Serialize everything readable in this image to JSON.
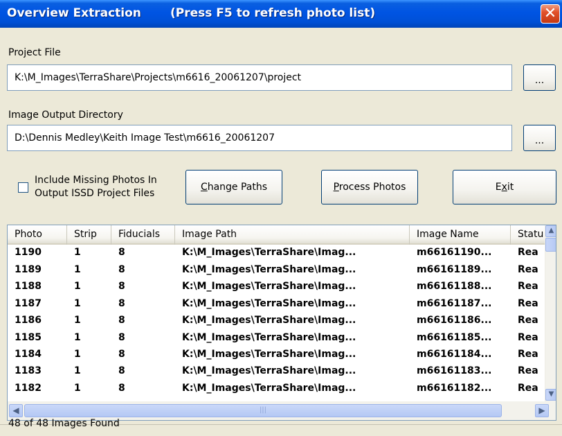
{
  "window": {
    "title": "Overview Extraction",
    "title_hint": "(Press F5 to refresh photo list)",
    "close_glyph": "✕"
  },
  "project_file": {
    "label": "Project File",
    "value": "K:\\M_Images\\TerraShare\\Projects\\m6616_20061207\\project",
    "browse_label": "..."
  },
  "output_dir": {
    "label": "Image Output Directory",
    "value": "D:\\Dennis Medley\\Keith Image Test\\m6616_20061207",
    "browse_label": "..."
  },
  "options": {
    "include_missing_line1": "Include Missing Photos In",
    "include_missing_line2": "Output ISSD Project Files",
    "include_missing_checked": false
  },
  "buttons": {
    "change_paths_u": "C",
    "change_paths_rest": "hange Paths",
    "process_photos_u": "P",
    "process_photos_rest": "rocess Photos",
    "exit_pre": "E",
    "exit_u": "x",
    "exit_rest": "it"
  },
  "table": {
    "columns": [
      "Photo",
      "Strip",
      "Fiducials",
      "Image Path",
      "Image Name",
      "Statu"
    ],
    "rows": [
      [
        "1190",
        "1",
        "8",
        "K:\\M_Images\\TerraShare\\Imag...",
        "m66161190...",
        "Rea"
      ],
      [
        "1189",
        "1",
        "8",
        "K:\\M_Images\\TerraShare\\Imag...",
        "m66161189...",
        "Rea"
      ],
      [
        "1188",
        "1",
        "8",
        "K:\\M_Images\\TerraShare\\Imag...",
        "m66161188...",
        "Rea"
      ],
      [
        "1187",
        "1",
        "8",
        "K:\\M_Images\\TerraShare\\Imag...",
        "m66161187...",
        "Rea"
      ],
      [
        "1186",
        "1",
        "8",
        "K:\\M_Images\\TerraShare\\Imag...",
        "m66161186...",
        "Rea"
      ],
      [
        "1185",
        "1",
        "8",
        "K:\\M_Images\\TerraShare\\Imag...",
        "m66161185...",
        "Rea"
      ],
      [
        "1184",
        "1",
        "8",
        "K:\\M_Images\\TerraShare\\Imag...",
        "m66161184...",
        "Rea"
      ],
      [
        "1183",
        "1",
        "8",
        "K:\\M_Images\\TerraShare\\Imag...",
        "m66161183...",
        "Rea"
      ],
      [
        "1182",
        "1",
        "8",
        "K:\\M_Images\\TerraShare\\Imag...",
        "m66161182...",
        "Rea"
      ]
    ]
  },
  "status": {
    "text": "48 of 48 Images Found"
  },
  "colors": {
    "titlebar": "#0054e3",
    "window_bg": "#ece9d8",
    "close_button": "#e2512b",
    "scrollbar": "#b4c8f4"
  },
  "icons": {
    "close": "close-icon",
    "scroll_up": "chevron-up-icon",
    "scroll_down": "chevron-down-icon",
    "scroll_left": "chevron-left-icon",
    "scroll_right": "chevron-right-icon"
  }
}
